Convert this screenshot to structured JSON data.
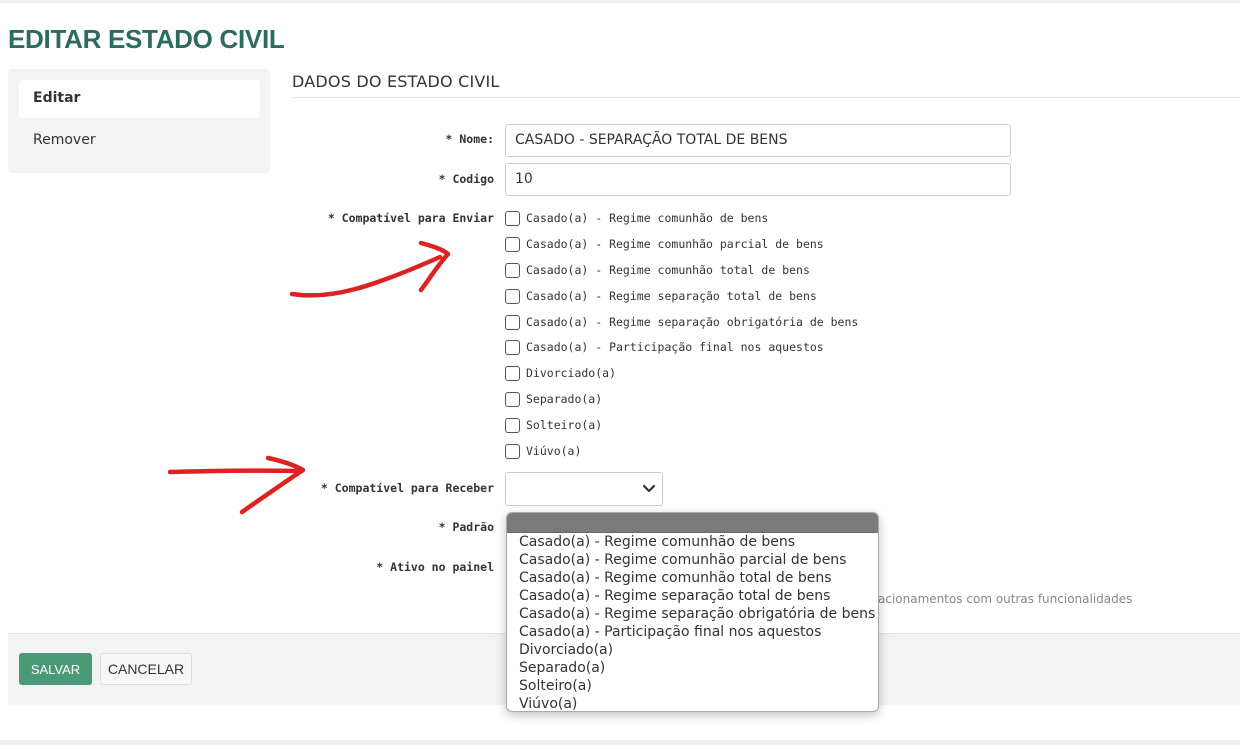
{
  "page": {
    "title": "EDITAR ESTADO CIVIL"
  },
  "sidebar": {
    "items": [
      {
        "label": "Editar",
        "active": true
      },
      {
        "label": "Remover",
        "active": false
      }
    ]
  },
  "section": {
    "title": "DADOS DO ESTADO CIVIL"
  },
  "form": {
    "nome": {
      "label": "* Nome:",
      "value": "CASADO - SEPARAÇÃO TOTAL DE BENS"
    },
    "codigo": {
      "label": "* Codigo",
      "value": "10"
    },
    "enviar": {
      "label": "* Compatível para Enviar",
      "options": [
        "Casado(a) - Regime comunhão de bens",
        "Casado(a) - Regime comunhão parcial de bens",
        "Casado(a) - Regime comunhão total de bens",
        "Casado(a) - Regime separação total de bens",
        "Casado(a) - Regime separação obrigatória de bens",
        "Casado(a) - Participação final nos aquestos",
        "Divorciado(a)",
        "Separado(a)",
        "Solteiro(a)",
        "Viúvo(a)"
      ]
    },
    "receber": {
      "label": "* Compatível para Receber",
      "value": "",
      "options": [
        "Casado(a) - Regime comunhão de bens",
        "Casado(a) - Regime comunhão parcial de bens",
        "Casado(a) - Regime comunhão total de bens",
        "Casado(a) - Regime separação total de bens",
        "Casado(a) - Regime separação obrigatória de bens",
        "Casado(a) - Participação final nos aquestos",
        "Divorciado(a)",
        "Separado(a)",
        "Solteiro(a)",
        "Viúvo(a)"
      ]
    },
    "padrao": {
      "label": "* Padrão"
    },
    "ativo": {
      "label": "* Ativo no painel",
      "hint": "acionamentos com outras funcionalidades"
    }
  },
  "actions": {
    "save": "SALVAR",
    "cancel": "CANCELAR"
  },
  "colors": {
    "title": "#2e6b5f",
    "save_button": "#4a9a77",
    "annotation_arrow": "#dd2222"
  },
  "icons": {
    "select_toggle": "chevron-down-icon",
    "annotation": "red-arrow-icon"
  }
}
